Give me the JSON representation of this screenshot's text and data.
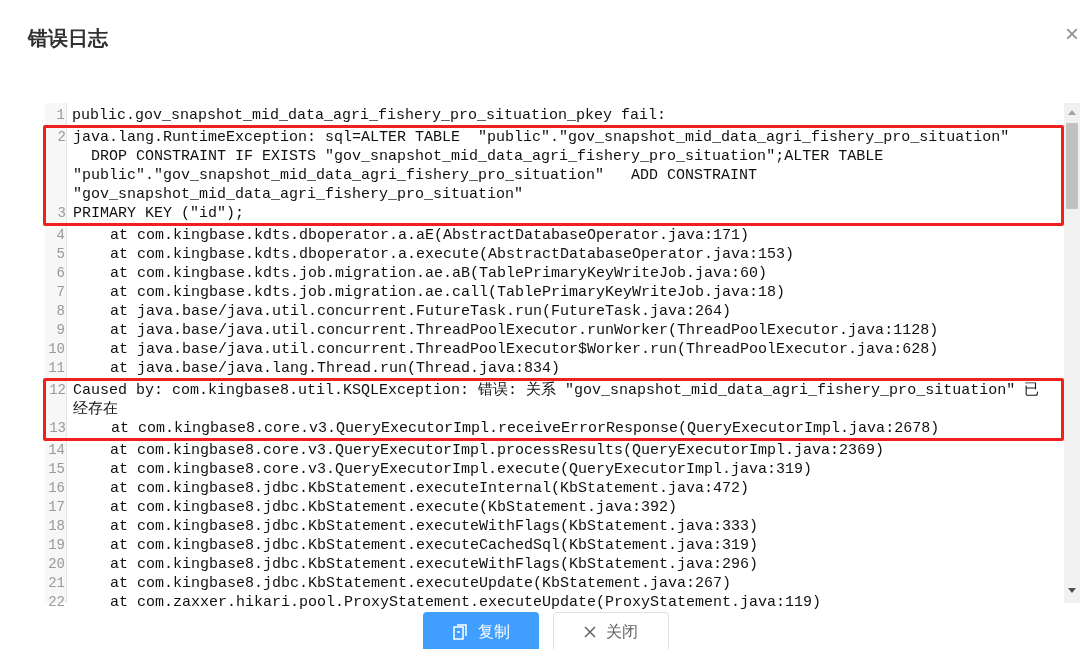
{
  "dialog": {
    "title": "错误日志",
    "close": "×"
  },
  "log": {
    "lines": [
      {
        "number": "1",
        "highlighted": false,
        "text": "public.gov_snapshot_mid_data_agri_fishery_pro_situation_pkey fail:"
      },
      {
        "number": "2",
        "highlighted": true,
        "text": "java.lang.RuntimeException: sql=ALTER TABLE  \"public\".\"gov_snapshot_mid_data_agri_fishery_pro_situation\"\n  DROP CONSTRAINT IF EXISTS \"gov_snapshot_mid_data_agri_fishery_pro_situation\";ALTER TABLE\n\"public\".\"gov_snapshot_mid_data_agri_fishery_pro_situation\"   ADD CONSTRAINT\n\"gov_snapshot_mid_data_agri_fishery_pro_situation\""
      },
      {
        "number": "3",
        "highlighted": true,
        "text": "PRIMARY KEY (\"id\");"
      },
      {
        "number": "4",
        "highlighted": false,
        "text": "\tat com.kingbase.kdts.dboperator.a.aE(AbstractDatabaseOperator.java:171)"
      },
      {
        "number": "5",
        "highlighted": false,
        "text": "\tat com.kingbase.kdts.dboperator.a.execute(AbstractDatabaseOperator.java:153)"
      },
      {
        "number": "6",
        "highlighted": false,
        "text": "\tat com.kingbase.kdts.job.migration.ae.aB(TablePrimaryKeyWriteJob.java:60)"
      },
      {
        "number": "7",
        "highlighted": false,
        "text": "\tat com.kingbase.kdts.job.migration.ae.call(TablePrimaryKeyWriteJob.java:18)"
      },
      {
        "number": "8",
        "highlighted": false,
        "text": "\tat java.base/java.util.concurrent.FutureTask.run(FutureTask.java:264)"
      },
      {
        "number": "9",
        "highlighted": false,
        "text": "\tat java.base/java.util.concurrent.ThreadPoolExecutor.runWorker(ThreadPoolExecutor.java:1128)"
      },
      {
        "number": "10",
        "highlighted": false,
        "text": "\tat java.base/java.util.concurrent.ThreadPoolExecutor$Worker.run(ThreadPoolExecutor.java:628)"
      },
      {
        "number": "11",
        "highlighted": false,
        "text": "\tat java.base/java.lang.Thread.run(Thread.java:834)"
      },
      {
        "number": "12",
        "highlighted": true,
        "text": "Caused by: com.kingbase8.util.KSQLException: 错误: 关系 \"gov_snapshot_mid_data_agri_fishery_pro_situation\" 已经存在"
      },
      {
        "number": "13",
        "highlighted": true,
        "text": "\tat com.kingbase8.core.v3.QueryExecutorImpl.receiveErrorResponse(QueryExecutorImpl.java:2678)"
      },
      {
        "number": "14",
        "highlighted": false,
        "text": "\tat com.kingbase8.core.v3.QueryExecutorImpl.processResults(QueryExecutorImpl.java:2369)"
      },
      {
        "number": "15",
        "highlighted": false,
        "text": "\tat com.kingbase8.core.v3.QueryExecutorImpl.execute(QueryExecutorImpl.java:319)"
      },
      {
        "number": "16",
        "highlighted": false,
        "text": "\tat com.kingbase8.jdbc.KbStatement.executeInternal(KbStatement.java:472)"
      },
      {
        "number": "17",
        "highlighted": false,
        "text": "\tat com.kingbase8.jdbc.KbStatement.execute(KbStatement.java:392)"
      },
      {
        "number": "18",
        "highlighted": false,
        "text": "\tat com.kingbase8.jdbc.KbStatement.executeWithFlags(KbStatement.java:333)"
      },
      {
        "number": "19",
        "highlighted": false,
        "text": "\tat com.kingbase8.jdbc.KbStatement.executeCachedSql(KbStatement.java:319)"
      },
      {
        "number": "20",
        "highlighted": false,
        "text": "\tat com.kingbase8.jdbc.KbStatement.executeWithFlags(KbStatement.java:296)"
      },
      {
        "number": "21",
        "highlighted": false,
        "text": "\tat com.kingbase8.jdbc.KbStatement.executeUpdate(KbStatement.java:267)"
      },
      {
        "number": "22",
        "highlighted": false,
        "text": "\tat com.zaxxer.hikari.pool.ProxyStatement.executeUpdate(ProxyStatement.java:119)"
      }
    ]
  },
  "buttons": [
    {
      "kind": "primary",
      "label": "复制"
    },
    {
      "kind": "default",
      "label": "关闭"
    }
  ]
}
